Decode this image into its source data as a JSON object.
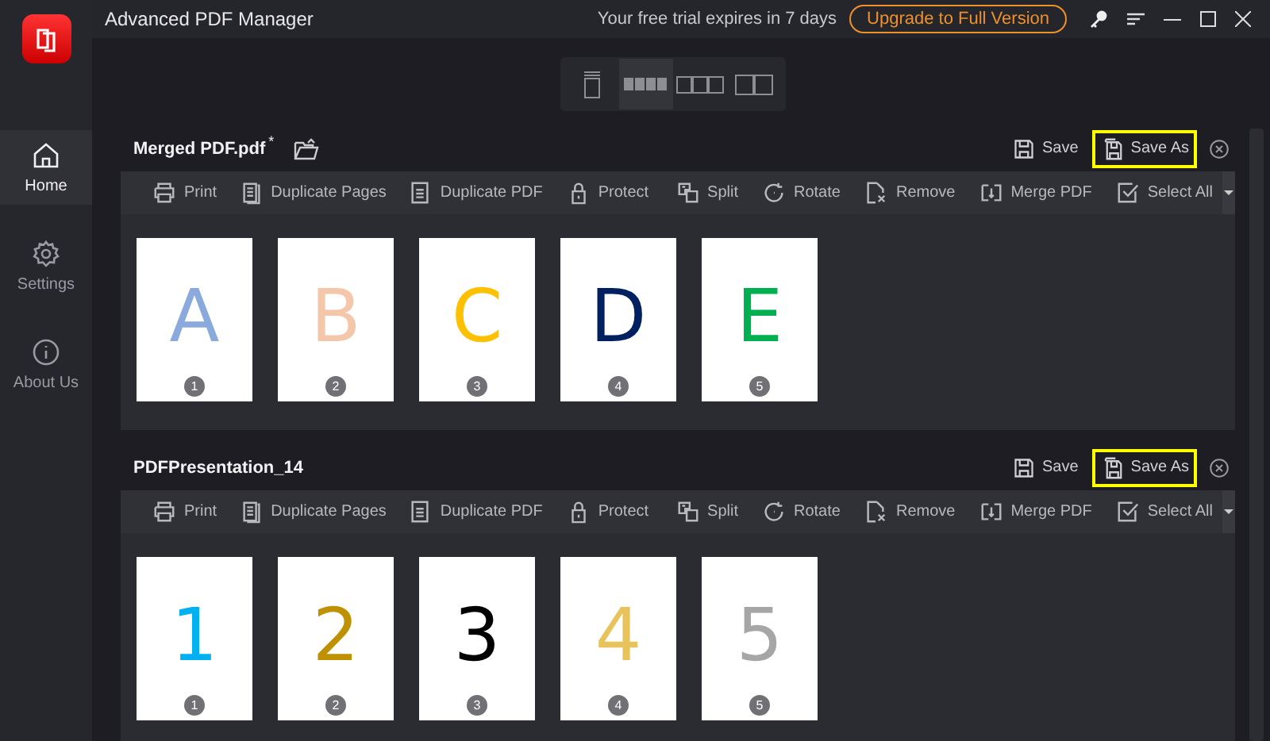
{
  "window": {
    "title": "Advanced PDF Manager"
  },
  "trial": {
    "message": "Your free trial expires in 7 days",
    "upgrade_button": "Upgrade to Full Version"
  },
  "view_modes": [
    {
      "selected": false
    },
    {
      "selected": true
    },
    {
      "selected": false
    },
    {
      "selected": false
    }
  ],
  "sidebar": {
    "items": [
      {
        "label": "Home",
        "selected": true
      },
      {
        "label": "Settings",
        "selected": false
      },
      {
        "label": "About Us",
        "selected": false
      }
    ]
  },
  "documents": [
    {
      "title": "Merged PDF.pdf",
      "modified_mark": "*",
      "save": "Save",
      "save_as": {
        "label": "Save As",
        "highlighted": true
      },
      "toolbar": [
        "Print",
        "Duplicate Pages",
        "Duplicate PDF",
        "Protect",
        "Split",
        "Rotate",
        "Remove",
        "Merge PDF",
        "Select All"
      ],
      "pages": [
        {
          "glyph": "A",
          "color": "#8aa9dc",
          "number": "1"
        },
        {
          "glyph": "B",
          "color": "#f4c7ab",
          "number": "2"
        },
        {
          "glyph": "C",
          "color": "#ffc000",
          "number": "3"
        },
        {
          "glyph": "D",
          "color": "#002060",
          "number": "4"
        },
        {
          "glyph": "E",
          "color": "#00b050",
          "number": "5"
        }
      ]
    },
    {
      "title": "PDFPresentation_14",
      "save": "Save",
      "save_as": {
        "label": "Save As",
        "highlighted": true
      },
      "toolbar": [
        "Print",
        "Duplicate Pages",
        "Duplicate PDF",
        "Protect",
        "Split",
        "Rotate",
        "Remove",
        "Merge PDF",
        "Select All"
      ],
      "pages": [
        {
          "glyph": "1",
          "color": "#00b0f0",
          "number": "1"
        },
        {
          "glyph": "2",
          "color": "#bf9000",
          "number": "2"
        },
        {
          "glyph": "3",
          "color": "#000000",
          "number": "3"
        },
        {
          "glyph": "4",
          "color": "#e8c25a",
          "number": "4"
        },
        {
          "glyph": "5",
          "color": "#a6a6a6",
          "number": "5"
        }
      ]
    }
  ]
}
